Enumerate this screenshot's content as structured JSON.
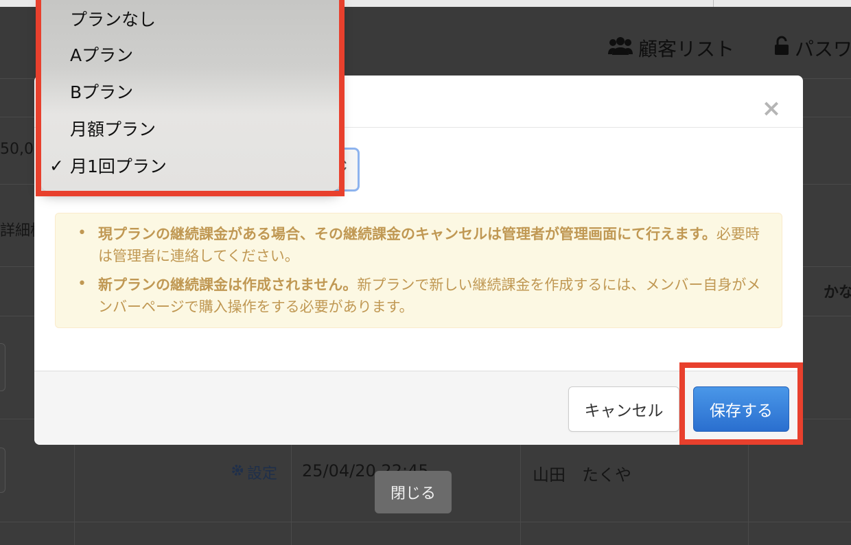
{
  "background": {
    "nav": {
      "customer_list_label": "顧客リスト",
      "customer_list_icon": "users-icon",
      "password_label": "パスワ",
      "password_icon": "lock-icon"
    },
    "row_fragments": {
      "amount_fragment": "50,0",
      "detail_search_fragment": "詳細検",
      "name_fragment": "かな"
    },
    "row": {
      "setting_label": "設定",
      "setting_icon": "gear-icon",
      "datetime": "25/04/20 22:45",
      "name": "山田　たくや"
    }
  },
  "dropdown": {
    "selected_index": 4,
    "options": [
      {
        "label": "プランなし"
      },
      {
        "label": "Aプラン"
      },
      {
        "label": "Bプラン"
      },
      {
        "label": "月額プラン"
      },
      {
        "label": "月1回プラン"
      }
    ],
    "check_glyph": "✓"
  },
  "modal": {
    "close_glyph": "×",
    "alert_items": [
      {
        "bold": "現プランの継続課金がある場合、その継続課金のキャンセルは管理者が管理画面にて行えます。",
        "normal": "必要時は管理者に連絡してください。"
      },
      {
        "bold": "新プランの継続課金は作成されません。",
        "normal": "新プランで新しい継続課金を作成するには、メンバー自身がメンバーページで購入操作をする必要があります。"
      }
    ],
    "cancel_label": "キャンセル",
    "save_label": "保存する"
  },
  "toast": {
    "close_label": "閉じる"
  },
  "colors": {
    "highlight": "#e8402d",
    "primary_button": "#2f7bd9",
    "alert_text": "#c09853",
    "alert_bg": "#fcf8e3"
  }
}
